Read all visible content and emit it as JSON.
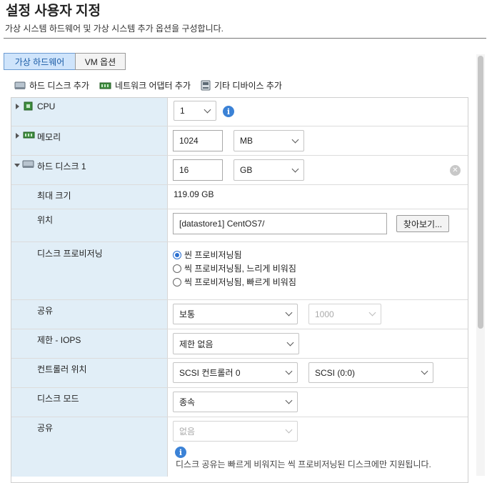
{
  "header": {
    "title": "설정 사용자 지정",
    "subtitle": "가상 시스템 하드웨어 및 가상 시스템 추가 옵션을 구성합니다."
  },
  "tabs": [
    {
      "label": "가상 하드웨어",
      "active": true
    },
    {
      "label": "VM 옵션",
      "active": false
    }
  ],
  "toolbar": {
    "add_disk": "하드 디스크 추가",
    "add_nic": "네트워크 어댑터 추가",
    "add_other": "기타 디바이스 추가"
  },
  "hardware": {
    "cpu": {
      "label": "CPU",
      "value": "1",
      "icon": "info-icon"
    },
    "memory": {
      "label": "메모리",
      "value": "1024",
      "unit": "MB"
    },
    "disk": {
      "label": "하드 디스크 1",
      "value": "16",
      "unit": "GB",
      "max_size_label": "최대 크기",
      "max_size_value": "119.09 GB",
      "location_label": "위치",
      "location_value": "[datastore1] CentOS7/",
      "browse_label": "찾아보기...",
      "provisioning_label": "디스크 프로비저닝",
      "provisioning_options": [
        {
          "label": "씬 프로비저닝됨",
          "selected": true
        },
        {
          "label": "씩 프로비저닝됨, 느리게 비워짐",
          "selected": false
        },
        {
          "label": "씩 프로비저닝됨, 빠르게 비워짐",
          "selected": false
        }
      ],
      "shares_label": "공유",
      "shares_value": "보통",
      "shares_number": "1000",
      "limit_label": "제한 - IOPS",
      "limit_value": "제한 없음",
      "controller_label": "컨트롤러 위치",
      "controller_value": "SCSI 컨트롤러 0",
      "controller_slot": "SCSI (0:0)",
      "mode_label": "디스크 모드",
      "mode_value": "종속",
      "sharing_label": "공유",
      "sharing_value": "없음",
      "sharing_note": "디스크 공유는 빠르게 비워지는 씩 프로비저닝된 디스크에만 지원됩니다."
    }
  },
  "colors": {
    "accent": "#3b82d6",
    "tab_active_bg": "#cfe4fb",
    "label_column_bg": "#e1eef7"
  }
}
